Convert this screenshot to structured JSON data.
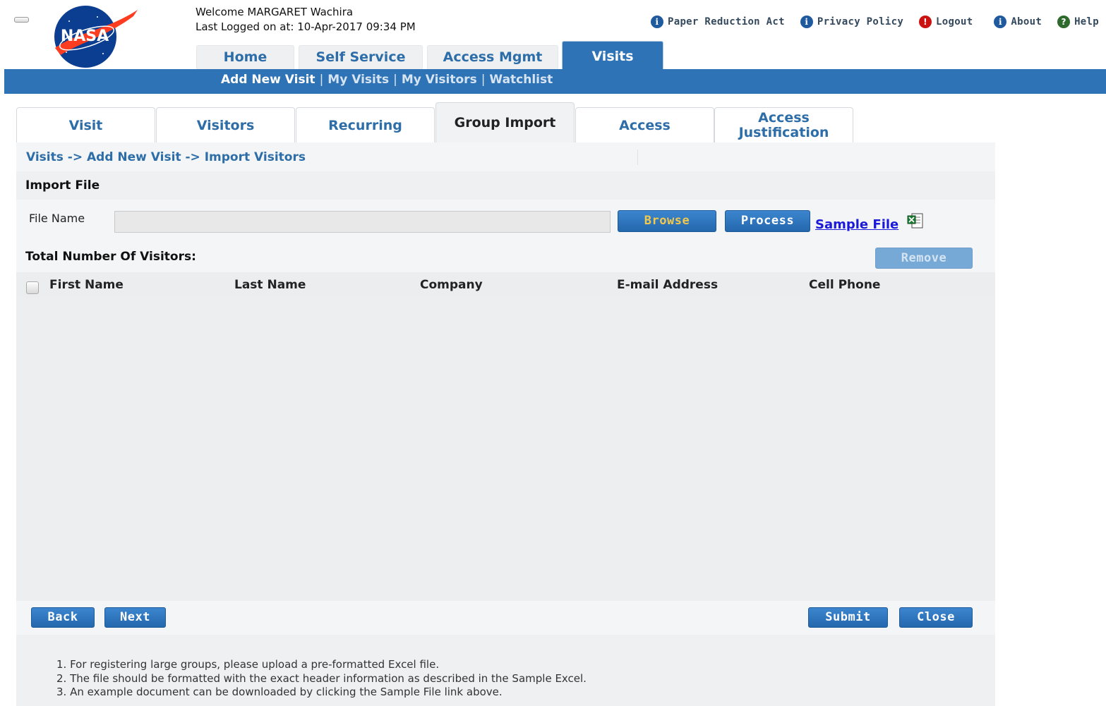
{
  "header": {
    "logo_text": "NASA",
    "welcome": "Welcome MARGARET Wachira",
    "last_logged": "Last Logged on at: 10-Apr-2017 09:34 PM",
    "top_links": [
      {
        "label": "Paper Reduction Act",
        "icon": "info-icon"
      },
      {
        "label": "Privacy Policy",
        "icon": "info-icon"
      },
      {
        "label": "Logout",
        "icon": "alert-icon"
      },
      {
        "label": "About",
        "icon": "info-icon"
      },
      {
        "label": "Help",
        "icon": "help-icon"
      }
    ]
  },
  "nav": {
    "tabs": [
      "Home",
      "Self Service",
      "Access Mgmt",
      "Visits"
    ],
    "active": "Visits",
    "sub_items": [
      "Add New Visit",
      "My Visits",
      "My Visitors",
      "Watchlist"
    ],
    "sub_separator": "|",
    "sub_active": "Add New Visit"
  },
  "visit_tabs": {
    "tabs": [
      "Visit",
      "Visitors",
      "Recurring",
      "Group Import",
      "Access",
      "Access Justification"
    ],
    "active": "Group Import"
  },
  "content": {
    "breadcrumb": "Visits -> Add New Visit -> Import Visitors",
    "import_title": "Import File",
    "file_label": "File Name",
    "file_value": "",
    "browse_label": "Browse",
    "process_label": "Process",
    "sample_link": "Sample File",
    "total_label": "Total Number Of Visitors:",
    "remove_label": "Remove",
    "columns": [
      "First Name",
      "Last Name",
      "Company",
      "E-mail Address",
      "Cell Phone"
    ],
    "rows": []
  },
  "actions": {
    "back": "Back",
    "next": "Next",
    "submit": "Submit",
    "close": "Close"
  },
  "notes": [
    "1. For registering large groups, please upload a pre-formatted Excel file.",
    "2. The file should be formatted with the exact header information as described in the Sample Excel.",
    "3. An example document can be downloaded by clicking the Sample File link above."
  ],
  "colors": {
    "brand_blue": "#2e73b6",
    "link_blue": "#2d6da8",
    "panel_bg": "#f4f5f6"
  }
}
